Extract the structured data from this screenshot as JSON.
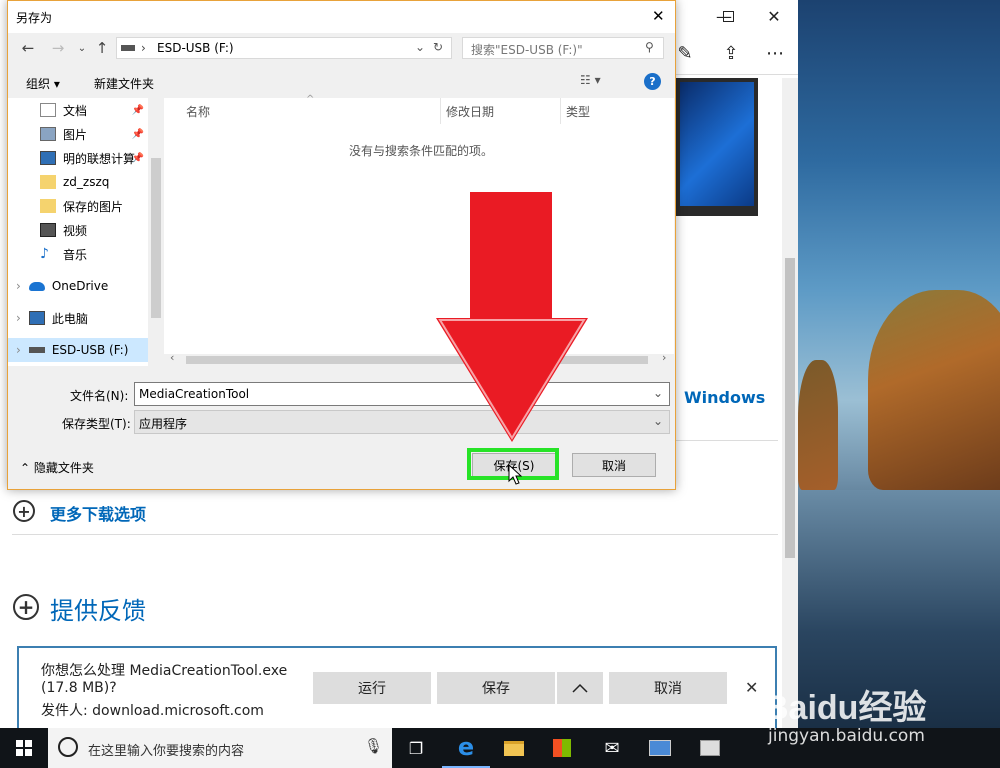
{
  "dialog": {
    "title": "另存为",
    "address": {
      "drive": "ESD-USB (F:)"
    },
    "search_placeholder": "搜索\"ESD-USB (F:)\"",
    "toolbar": {
      "organize": "组织 ▾",
      "new_folder": "新建文件夹",
      "help": "?"
    },
    "sidebar": [
      {
        "label": "文档",
        "pinned": true
      },
      {
        "label": "图片",
        "pinned": true
      },
      {
        "label": "明的联想计算",
        "pinned": true
      },
      {
        "label": "zd_zszq",
        "pinned": false
      },
      {
        "label": "保存的图片",
        "pinned": false
      },
      {
        "label": "视频",
        "pinned": false
      },
      {
        "label": "音乐",
        "pinned": false
      }
    ],
    "tree": [
      {
        "label": "OneDrive"
      },
      {
        "label": "此电脑"
      },
      {
        "label": "ESD-USB (F:)"
      }
    ],
    "columns": {
      "name": "名称",
      "modified": "修改日期",
      "type": "类型"
    },
    "empty_text": "没有与搜索条件匹配的项。",
    "filename_label": "文件名(N):",
    "filename_value": "MediaCreationTool",
    "filetype_label": "保存类型(T):",
    "filetype_value": "应用程序",
    "hide_folders": "隐藏文件夹",
    "save_button": "保存(S)",
    "cancel_button": "取消"
  },
  "browser": {
    "windows_link_fragment": "Windows",
    "more_downloads": "更多下载选项",
    "feedback": "提供反馈"
  },
  "download_bar": {
    "question": "你想怎么处理 MediaCreationTool.exe",
    "size": "(17.8 MB)?",
    "publisher": "发件人: download.microsoft.com",
    "run": "运行",
    "save": "保存",
    "cancel": "取消"
  },
  "taskbar": {
    "search_placeholder": "在这里输入你要搜索的内容"
  },
  "watermark": {
    "brand": "Baidu经验",
    "url": "jingyan.baidu.com"
  },
  "colors": {
    "accent": "#0067b8",
    "highlight": "#27e327",
    "arrow": "#ea1b24",
    "dialog_border": "#e8a23a"
  }
}
